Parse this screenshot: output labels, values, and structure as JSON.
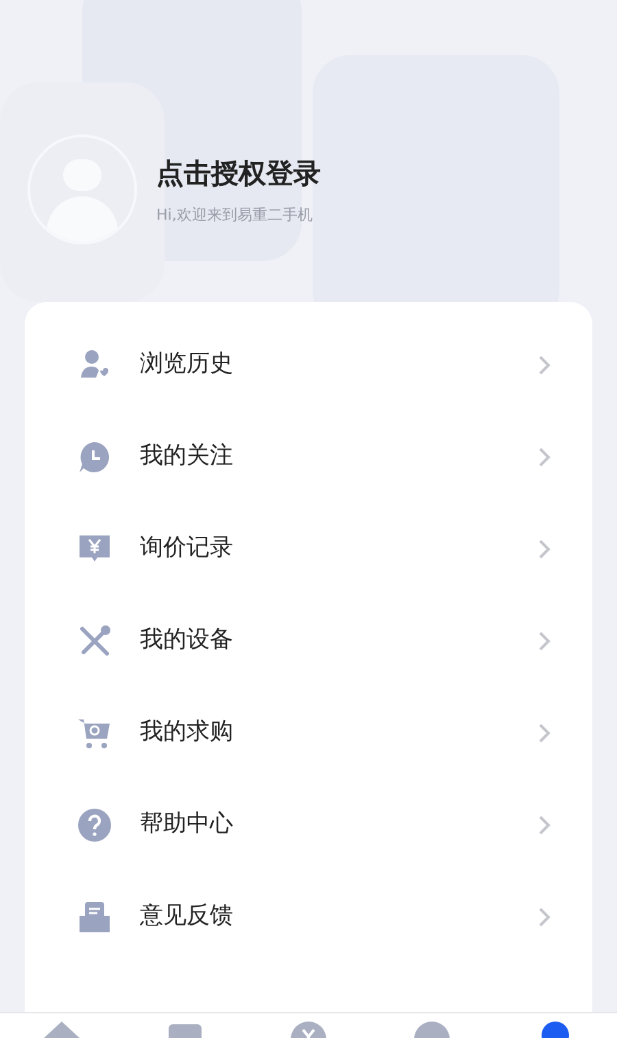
{
  "profile": {
    "title": "点击授权登录",
    "subtitle": "Hi,欢迎来到易重二手机"
  },
  "menu": [
    {
      "label": "浏览历史"
    },
    {
      "label": "我的关注"
    },
    {
      "label": "询价记录"
    },
    {
      "label": "我的设备"
    },
    {
      "label": "我的求购"
    },
    {
      "label": "帮助中心"
    },
    {
      "label": "意见反馈"
    }
  ],
  "tab_bar": [
    {
      "selected": false
    },
    {
      "selected": false
    },
    {
      "selected": false
    },
    {
      "selected": false
    },
    {
      "selected": true
    }
  ]
}
